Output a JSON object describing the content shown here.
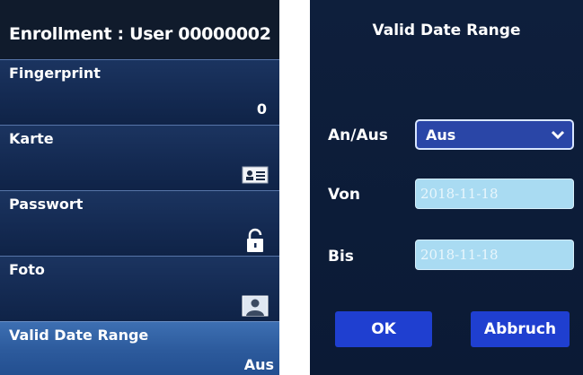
{
  "left_screen": {
    "header": "Enrollment : User 00000002",
    "rows": [
      {
        "label": "Fingerprint",
        "value": "0"
      },
      {
        "label": "Karte",
        "icon": "id-card-icon"
      },
      {
        "label": "Passwort",
        "icon": "padlock-icon"
      },
      {
        "label": "Foto",
        "icon": "user-photo-icon"
      },
      {
        "label": "Valid Date Range",
        "value": "Aus",
        "selected": true
      }
    ]
  },
  "right_screen": {
    "title": "Valid Date Range",
    "on_off": {
      "label": "An/Aus",
      "selected": "Aus"
    },
    "from": {
      "label": "Von",
      "value": "2018-11-18"
    },
    "to": {
      "label": "Bis",
      "value": "2018-11-18"
    },
    "buttons": {
      "ok": "OK",
      "cancel": "Abbruch"
    }
  },
  "colors": {
    "header_bg": "#101b2c",
    "row_bg": "#142a52",
    "row_selected_bg": "#2c5a9c",
    "dropdown_bg": "#2a46a7",
    "date_field_bg": "#a9dbf2",
    "button_bg": "#1f3fd0"
  }
}
